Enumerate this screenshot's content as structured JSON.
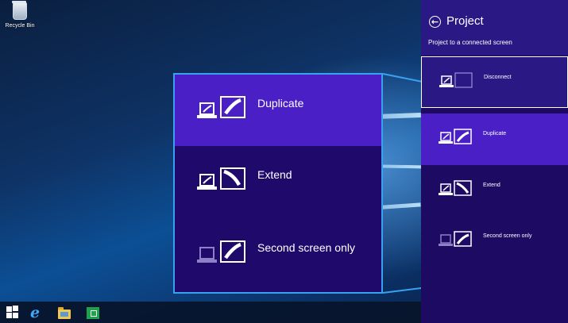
{
  "desktop": {
    "recycle_bin_label": "Recycle Bin"
  },
  "taskbar": {
    "items": [
      "start-icon",
      "internet-explorer-icon",
      "file-explorer-icon",
      "store-icon"
    ]
  },
  "project_panel": {
    "title": "Project",
    "subtitle": "Project to a connected screen",
    "options": [
      {
        "label": "Disconnect",
        "state": "focused"
      },
      {
        "label": "Duplicate",
        "state": "selected"
      },
      {
        "label": "Extend",
        "state": "normal"
      },
      {
        "label": "Second screen only",
        "state": "normal"
      }
    ]
  },
  "zoom_callout": {
    "options": [
      {
        "label": "Duplicate",
        "state": "selected"
      },
      {
        "label": "Extend",
        "state": "normal"
      },
      {
        "label": "Second screen only",
        "state": "normal"
      }
    ]
  },
  "colors": {
    "panel_bg": "#1c0a63",
    "header_bg": "#2a1884",
    "selected_bg": "#4a1fc6",
    "callout_border": "#3aa1f0"
  }
}
